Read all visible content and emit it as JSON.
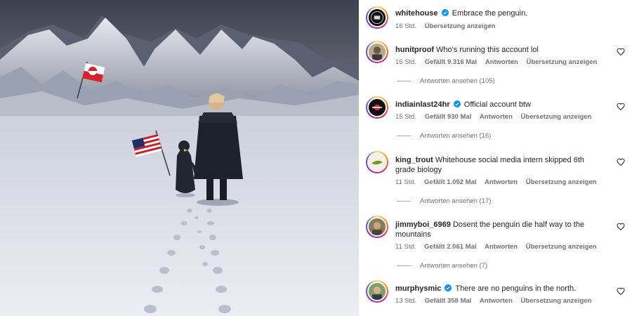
{
  "caption": {
    "username": "whitehouse",
    "verified": true,
    "text": "Embrace the penguin.",
    "time": "16 Std.",
    "translate": "Übersetzung anzeigen"
  },
  "comments": [
    {
      "username": "hunitproof",
      "verified": false,
      "text": "Who's running this account lol",
      "time": "16 Std.",
      "likes": "Gefällt 9.316 Mal",
      "reply": "Antworten",
      "translate": "Übersetzung anzeigen",
      "view_replies": "Antworten ansehen (105)"
    },
    {
      "username": "indiainlast24hr",
      "verified": true,
      "text": "Official account btw",
      "time": "15 Std.",
      "likes": "Gefällt 930 Mal",
      "reply": "Antworten",
      "translate": "Übersetzung anzeigen",
      "view_replies": "Antworten ansehen (16)"
    },
    {
      "username": "king_trout",
      "verified": false,
      "text": "Whitehouse social media intern skipped 6th grade biology",
      "time": "11 Std.",
      "likes": "Gefällt 1.052 Mal",
      "reply": "Antworten",
      "translate": "Übersetzung anzeigen",
      "view_replies": "Antworten ansehen (17)"
    },
    {
      "username": "jimmyboi_6969",
      "verified": false,
      "text": "Dosent the penguin die half way to the mountains",
      "time": "11 Std.",
      "likes": "Gefällt 2.061 Mal",
      "reply": "Antworten",
      "translate": "Übersetzung anzeigen",
      "view_replies": "Antworten ansehen (7)"
    },
    {
      "username": "murphysmic",
      "verified": true,
      "text": "There are no penguins in the north.",
      "time": "13 Std.",
      "likes": "Gefällt 358 Mal",
      "reply": "Antworten",
      "translate": "Übersetzung anzeigen"
    }
  ],
  "icons": {
    "verified": "verified-badge-icon",
    "like": "heart-outline-icon"
  },
  "colors": {
    "verified_blue": "#0095f6",
    "meta_gray": "#737373",
    "text": "#262626"
  }
}
